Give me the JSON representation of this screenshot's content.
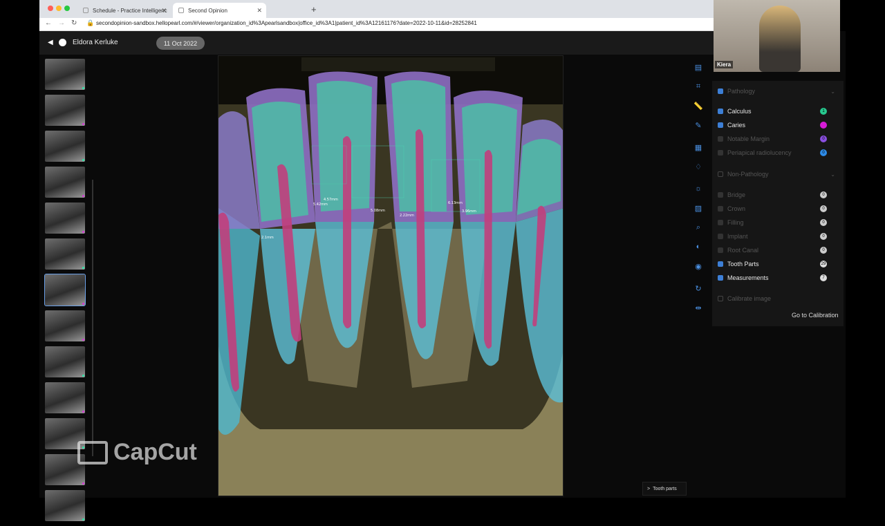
{
  "browser": {
    "tabs": [
      {
        "label": "Schedule - Practice Intelligenc"
      },
      {
        "label": "Second Opinion"
      }
    ],
    "new_tab_symbol": "+",
    "url": "secondopinion-sandbox.hellopearl.com/#/viewer/organization_id%3Apearlsandbox|office_id%3A1|patient_id%3A1216117​6?date=2022-10-11&id=28252841"
  },
  "header": {
    "patient_name": "Eldora Kerluke",
    "date": "11 Oct 2022"
  },
  "thumbnails": {
    "count": 13,
    "selected_index": 6,
    "dot_colors": [
      "#2ee6a8",
      "#d63ad6",
      "#2ee6a8",
      "#d63ad6",
      "#d63ad6",
      "#2ee6a8",
      "#d63ad6",
      "#d63ad6",
      "#2ee6a8",
      "#d63ad6",
      "#2ee6a8",
      "#d63ad6",
      "#2ee6a8"
    ]
  },
  "xray": {
    "measurements": [
      "5.42mm",
      "4.57mm",
      "5.08mm",
      "2.22mm",
      "6.13mm",
      "3.96mm",
      "2.1mm"
    ]
  },
  "watermark": {
    "text": "CapCut"
  },
  "toolbar": {
    "icons": [
      "layout-icon",
      "crop-icon",
      "ruler-icon",
      "pen-icon",
      "tooth-scan-icon",
      "tooth-icon",
      "brightness-icon",
      "image-adjust-icon",
      "zoom-icon",
      "contrast-icon",
      "eye-icon",
      "rotate-icon",
      "flip-icon"
    ]
  },
  "panel": {
    "pathology": {
      "title": "Pathology",
      "items": [
        {
          "label": "Calculus",
          "checked": true,
          "count": "1",
          "color": "#27c98f"
        },
        {
          "label": "Caries",
          "checked": true,
          "count": "",
          "color": "#d61bd6"
        },
        {
          "label": "Notable Margin",
          "checked": false,
          "count": "0",
          "color": "#8a4fe0"
        },
        {
          "label": "Periapical radiolucency",
          "checked": false,
          "count": "0",
          "color": "#2d8be8"
        }
      ]
    },
    "non_pathology": {
      "title": "Non-Pathology",
      "items": [
        {
          "label": "Bridge",
          "checked": false,
          "count": "0"
        },
        {
          "label": "Crown",
          "checked": false,
          "count": "0"
        },
        {
          "label": "Filling",
          "checked": false,
          "count": "0"
        },
        {
          "label": "Implant",
          "checked": false,
          "count": "0"
        },
        {
          "label": "Root Canal",
          "checked": false,
          "count": "0"
        },
        {
          "label": "Tooth Parts",
          "checked": true,
          "count": "29"
        },
        {
          "label": "Measurements",
          "checked": true,
          "count": "7"
        }
      ]
    },
    "calibrate_label": "Calibrate image",
    "go_calibration_label": "Go to Calibration"
  },
  "webcam": {
    "name": "Kiera"
  },
  "chip": {
    "label": "Tooth parts",
    "arrow": ">"
  }
}
